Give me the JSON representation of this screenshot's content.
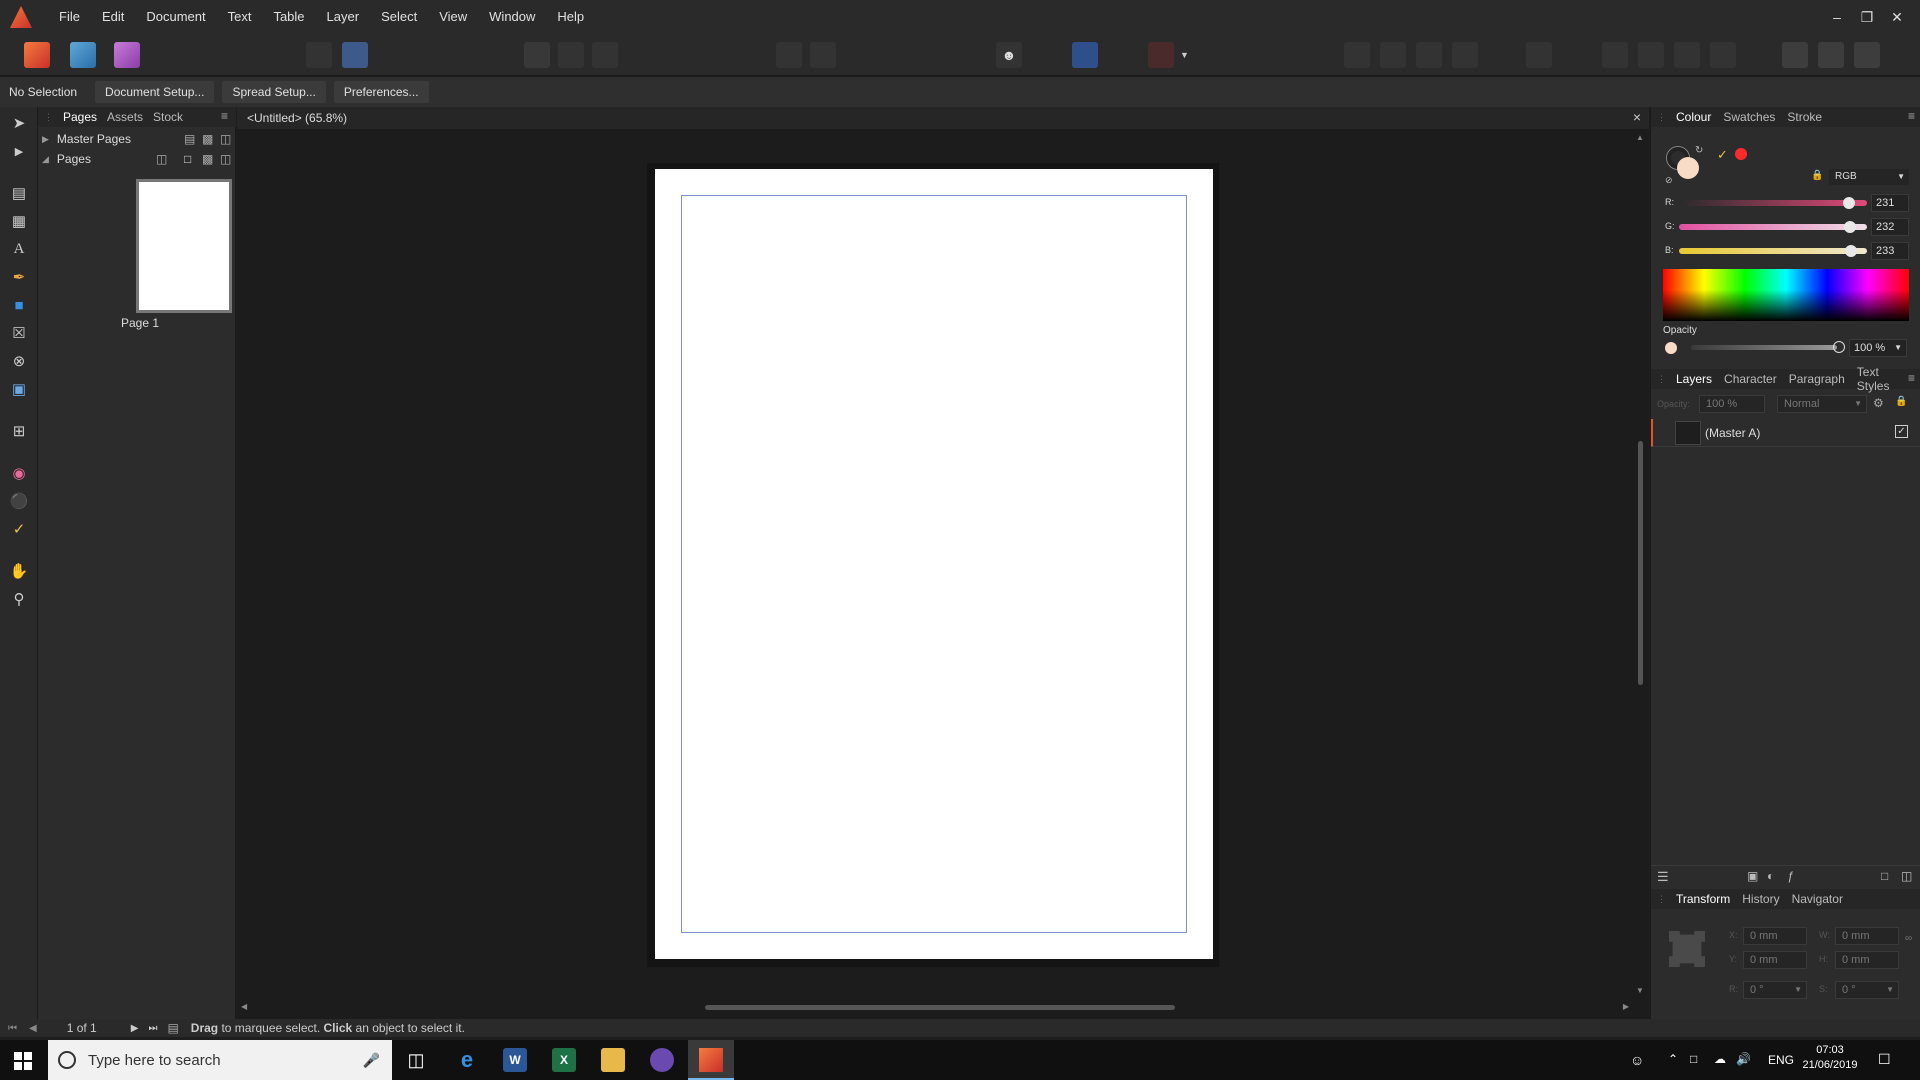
{
  "menubar": {
    "items": [
      "File",
      "Edit",
      "Document",
      "Text",
      "Table",
      "Layer",
      "Select",
      "View",
      "Window",
      "Help"
    ]
  },
  "context": {
    "selection": "No Selection",
    "buttons": [
      "Document Setup...",
      "Spread Setup...",
      "Preferences..."
    ]
  },
  "pages_panel": {
    "tabs": [
      "Pages",
      "Assets",
      "Stock"
    ],
    "master_pages": "Master Pages",
    "pages": "Pages",
    "page_label": "Page 1"
  },
  "document": {
    "tab_title": "<Untitled> (65.8%)",
    "close": "×"
  },
  "colour_panel": {
    "tabs": [
      "Colour",
      "Swatches",
      "Stroke"
    ],
    "model": "RGB",
    "r_label": "R:",
    "g_label": "G:",
    "b_label": "B:",
    "r": "231",
    "g": "232",
    "b": "233",
    "r_level": 0.906,
    "g_level": 0.91,
    "b_level": 0.914,
    "opacity_label": "Opacity",
    "opacity": "100 %"
  },
  "layers_panel": {
    "tabs": [
      "Layers",
      "Character",
      "Paragraph",
      "Text Styles"
    ],
    "opacity_label": "Opacity:",
    "opacity_value": "100 %",
    "blend_mode": "Normal",
    "layer_name": "(Master A)"
  },
  "transform_panel": {
    "tabs": [
      "Transform",
      "History",
      "Navigator"
    ],
    "x_label": "X:",
    "y_label": "Y:",
    "w_label": "W:",
    "h_label": "H:",
    "r_label": "R:",
    "s_label": "S:",
    "x": "0 mm",
    "y": "0 mm",
    "w": "0 mm",
    "h": "0 mm",
    "r": "0 °",
    "s": "0 °"
  },
  "status": {
    "page_count": "1 of 1",
    "hint_drag": "Drag",
    "hint_mid": " to marquee select. ",
    "hint_click": "Click",
    "hint_end": " an object to select it."
  },
  "taskbar": {
    "search_placeholder": "Type here to search",
    "language": "ENG",
    "time": "07:03",
    "date": "21/06/2019"
  },
  "colors": {
    "accent": "#e0562a",
    "hue_red": "#ff2a2a",
    "guide_blue": "#7f8fd0"
  }
}
